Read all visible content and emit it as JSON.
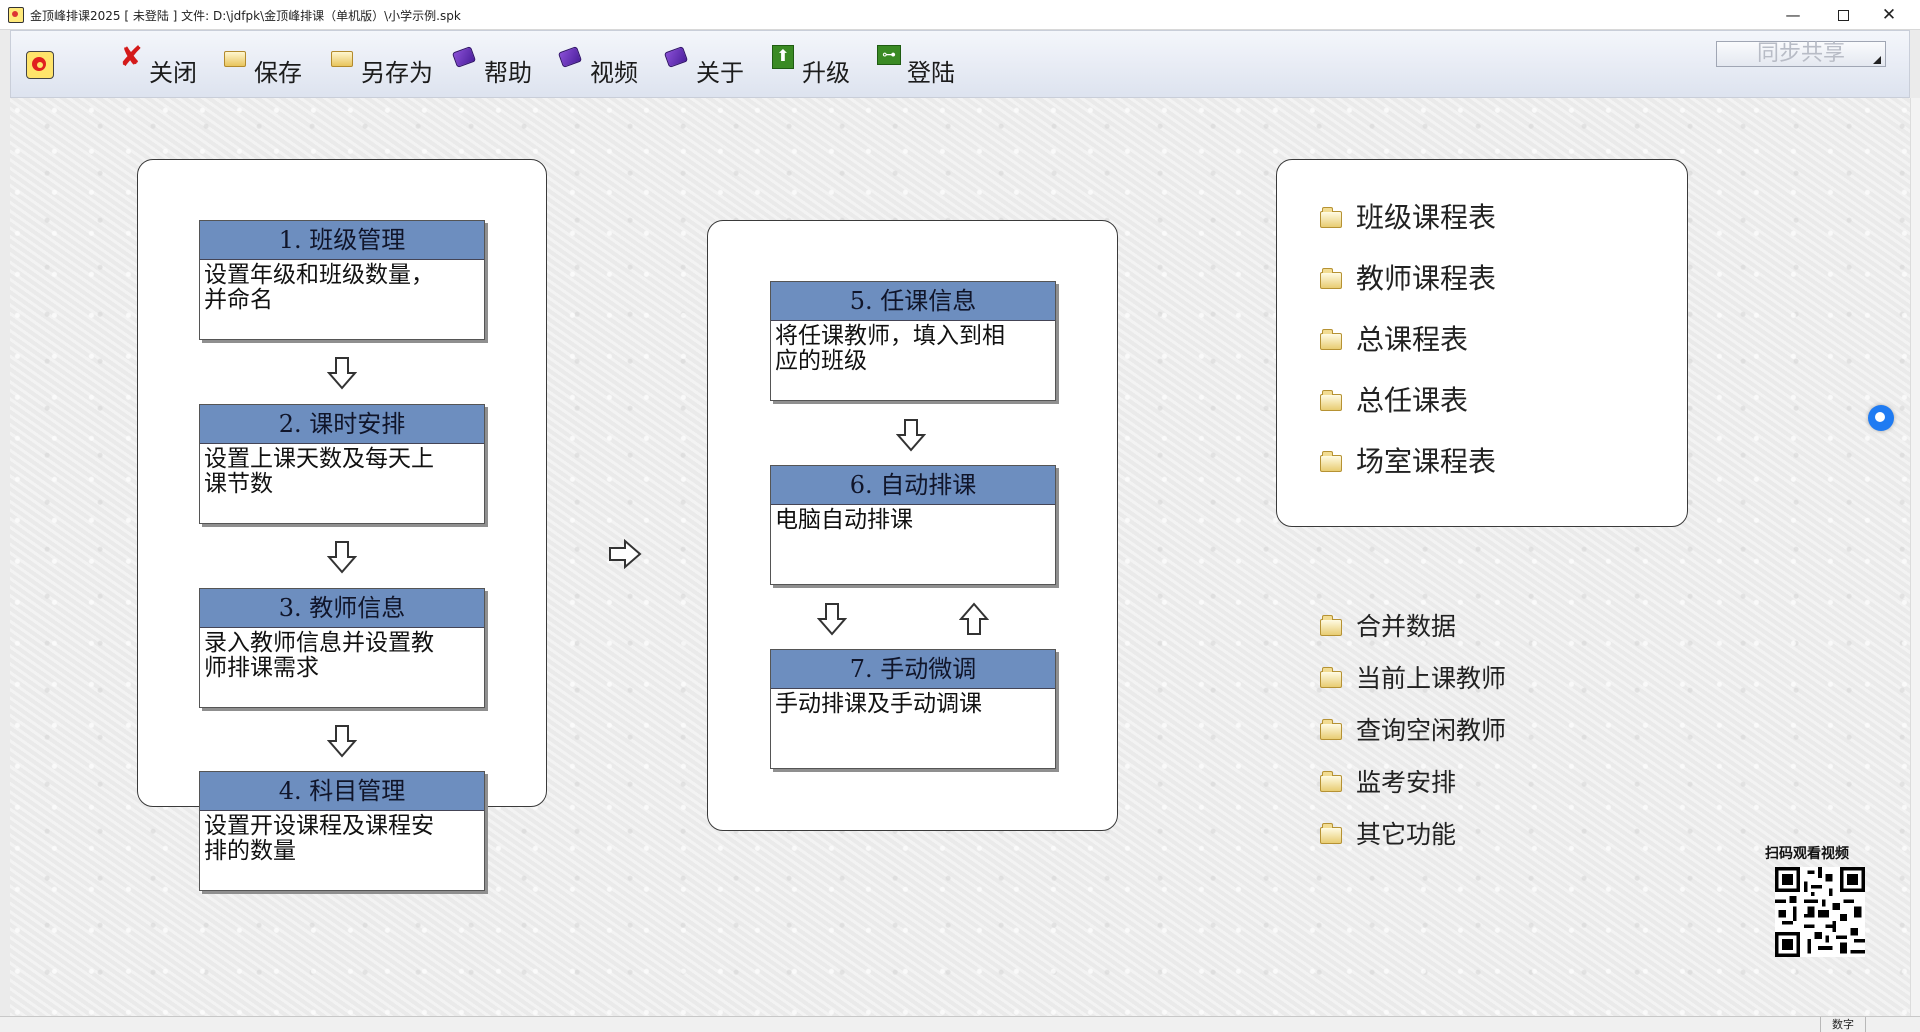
{
  "window": {
    "title": "金顶峰排课2025 [ 未登陆 ] 文件: D:\\jdfpk\\金顶峰排课（单机版）\\小学示例.spk",
    "minimize": "—",
    "maximize": "",
    "close": "✕"
  },
  "toolbar": {
    "items": [
      {
        "label": "关闭",
        "icon": "close-icon"
      },
      {
        "label": "保存",
        "icon": "folder-icon"
      },
      {
        "label": "另存为",
        "icon": "folder-icon"
      },
      {
        "label": "帮助",
        "icon": "book-icon"
      },
      {
        "label": "视频",
        "icon": "book-icon"
      },
      {
        "label": "关于",
        "icon": "book-icon"
      },
      {
        "label": "升级",
        "icon": "upgrade-icon"
      },
      {
        "label": "登陆",
        "icon": "key-icon"
      }
    ],
    "sync_label": "同步共享"
  },
  "steps": [
    {
      "head": "1.  班级管理",
      "line1": "设置年级和班级数量，",
      "line2": "并命名"
    },
    {
      "head": "2.  课时安排",
      "line1": "设置上课天数及每天上",
      "line2": "课节数"
    },
    {
      "head": "3.  教师信息",
      "line1": "录入教师信息并设置教",
      "line2": "师排课需求"
    },
    {
      "head": "4.  科目管理",
      "line1": "设置开设课程及课程安",
      "line2": "排的数量"
    },
    {
      "head": "5.  任课信息",
      "line1": "将任课教师，填入到相",
      "line2": "应的班级"
    },
    {
      "head": "6.  自动排课",
      "line1": "电脑自动排课",
      "line2": ""
    },
    {
      "head": "7.  手动微调",
      "line1": "手动排课及手动调课",
      "line2": ""
    }
  ],
  "reports": [
    "班级课程表",
    "教师课程表",
    "总课程表",
    "总任课表",
    "场室课程表"
  ],
  "tools": [
    "合并数据",
    "当前上课教师",
    "查询空闲教师",
    "监考安排",
    "其它功能"
  ],
  "qr_label": "扫码观看视频",
  "status": {
    "mode": "数字"
  },
  "colors": {
    "step_header": "#6d8ebf",
    "toolbar_bg": "#dde3ef",
    "close_icon": "#d41a1a"
  }
}
